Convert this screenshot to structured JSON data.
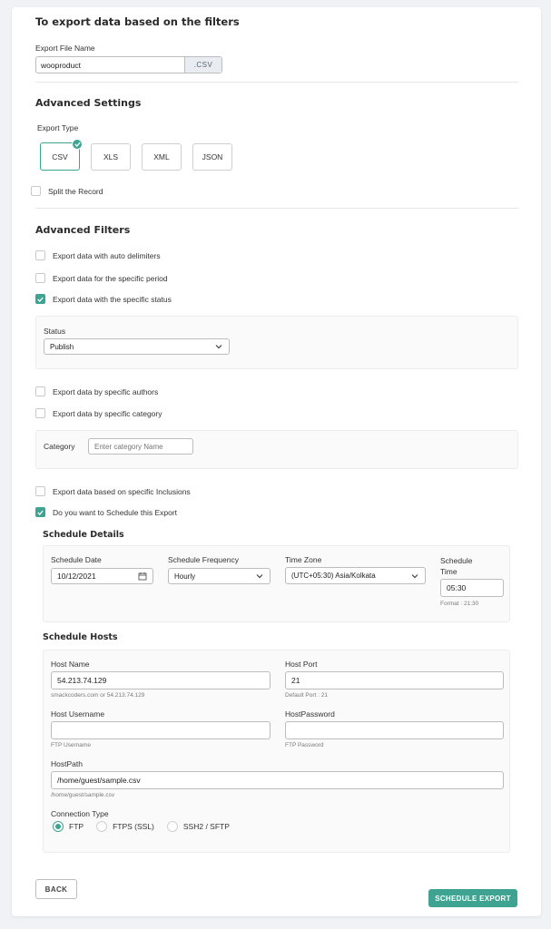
{
  "title": "To export data based on the filters",
  "file_name": {
    "label": "Export File Name",
    "value": "wooproduct",
    "suffix": ".CSV"
  },
  "advanced_settings": {
    "heading": "Advanced Settings",
    "export_type_label": "Export Type",
    "types": [
      "CSV",
      "XLS",
      "XML",
      "JSON"
    ],
    "selected_type": "CSV",
    "split_label": "Split the Record"
  },
  "advanced_filters": {
    "heading": "Advanced Filters",
    "auto_delimiters": "Export data with auto delimiters",
    "specific_period": "Export data for the specific period",
    "specific_status": "Export data with the specific status",
    "status_label": "Status",
    "status_value": "Publish",
    "by_authors": "Export data by specific authors",
    "by_category": "Export data by specific category",
    "category_label": "Category",
    "category_placeholder": "Enter category Name",
    "inclusions": "Export data based on specific Inclusions",
    "schedule_toggle": "Do you want to Schedule this Export"
  },
  "schedule_details": {
    "heading": "Schedule Details",
    "date_label": "Schedule Date",
    "date_value": "10/12/2021",
    "frequency_label": "Schedule Frequency",
    "frequency_value": "Hourly",
    "timezone_label": "Time Zone",
    "timezone_value": "(UTC+05:30) Asia/Kolkata",
    "time_label_line1": "Schedule",
    "time_label_line2": "Time",
    "time_value": "05:30",
    "time_hint": "Format : 21:30"
  },
  "schedule_hosts": {
    "heading": "Schedule Hosts",
    "host_name_label": "Host Name",
    "host_name_value": "54.213.74.129",
    "host_name_hint": "smackcoders.com or 54.213.74.129",
    "host_port_label": "Host Port",
    "host_port_value": "21",
    "host_port_hint": "Default Port : 21",
    "username_label": "Host Username",
    "username_value": "",
    "username_hint": "FTP Username",
    "password_label": "HostPassword",
    "password_value": "",
    "password_hint": "FTP Password",
    "path_label": "HostPath",
    "path_value": "/home/guest/sample.csv",
    "path_hint": "/home/guest/sample.csv",
    "connection_label": "Connection Type",
    "connection_options": [
      "FTP",
      "FTPS (SSL)",
      "SSH2 / SFTP"
    ],
    "connection_selected": "FTP"
  },
  "actions": {
    "back": "BACK",
    "schedule": "SCHEDULE EXPORT"
  },
  "colors": {
    "accent": "#3fa392",
    "background": "#f0f2f5"
  }
}
